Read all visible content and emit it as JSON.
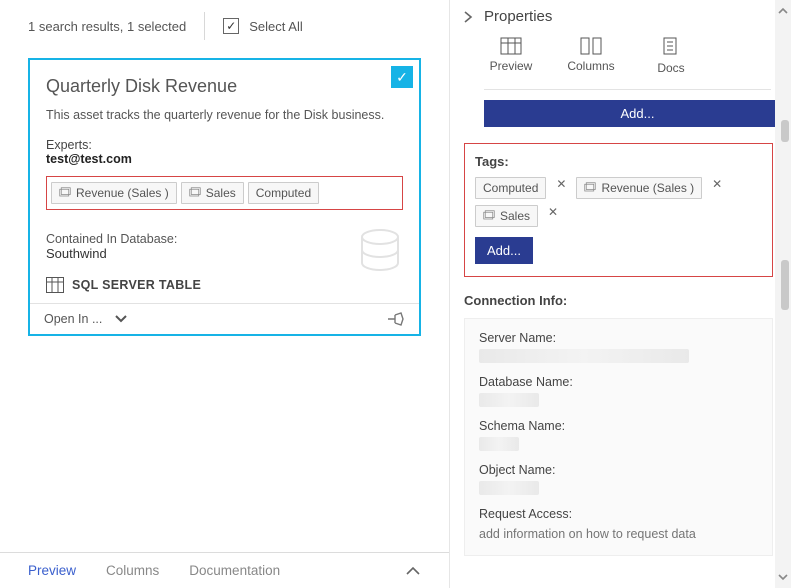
{
  "header": {
    "results_text": "1 search results, 1 selected",
    "select_all_label": "Select All"
  },
  "card": {
    "title": "Quarterly Disk Revenue",
    "description": "This asset tracks the quarterly revenue for the Disk business.",
    "experts_label": "Experts:",
    "experts_value": "test@test.com",
    "tags": [
      "Revenue (Sales )",
      "Sales",
      "Computed"
    ],
    "contained_label": "Contained In Database:",
    "contained_value": "Southwind",
    "source_type": "SQL SERVER TABLE",
    "open_in_label": "Open In ..."
  },
  "bottom_tabs": {
    "items": [
      "Preview",
      "Columns",
      "Documentation"
    ],
    "active_index": 0
  },
  "properties": {
    "title": "Properties",
    "tabs": [
      "Preview",
      "Columns",
      "Docs"
    ],
    "add_label": "Add...",
    "tags_section": {
      "label": "Tags:",
      "tags": [
        "Computed",
        "Revenue (Sales )",
        "Sales"
      ],
      "add_label": "Add..."
    },
    "connection": {
      "title": "Connection Info:",
      "fields": {
        "server_label": "Server Name:",
        "database_label": "Database Name:",
        "schema_label": "Schema Name:",
        "object_label": "Object Name:",
        "request_label": "Request Access:",
        "request_placeholder": "add information on how to request data"
      }
    }
  }
}
